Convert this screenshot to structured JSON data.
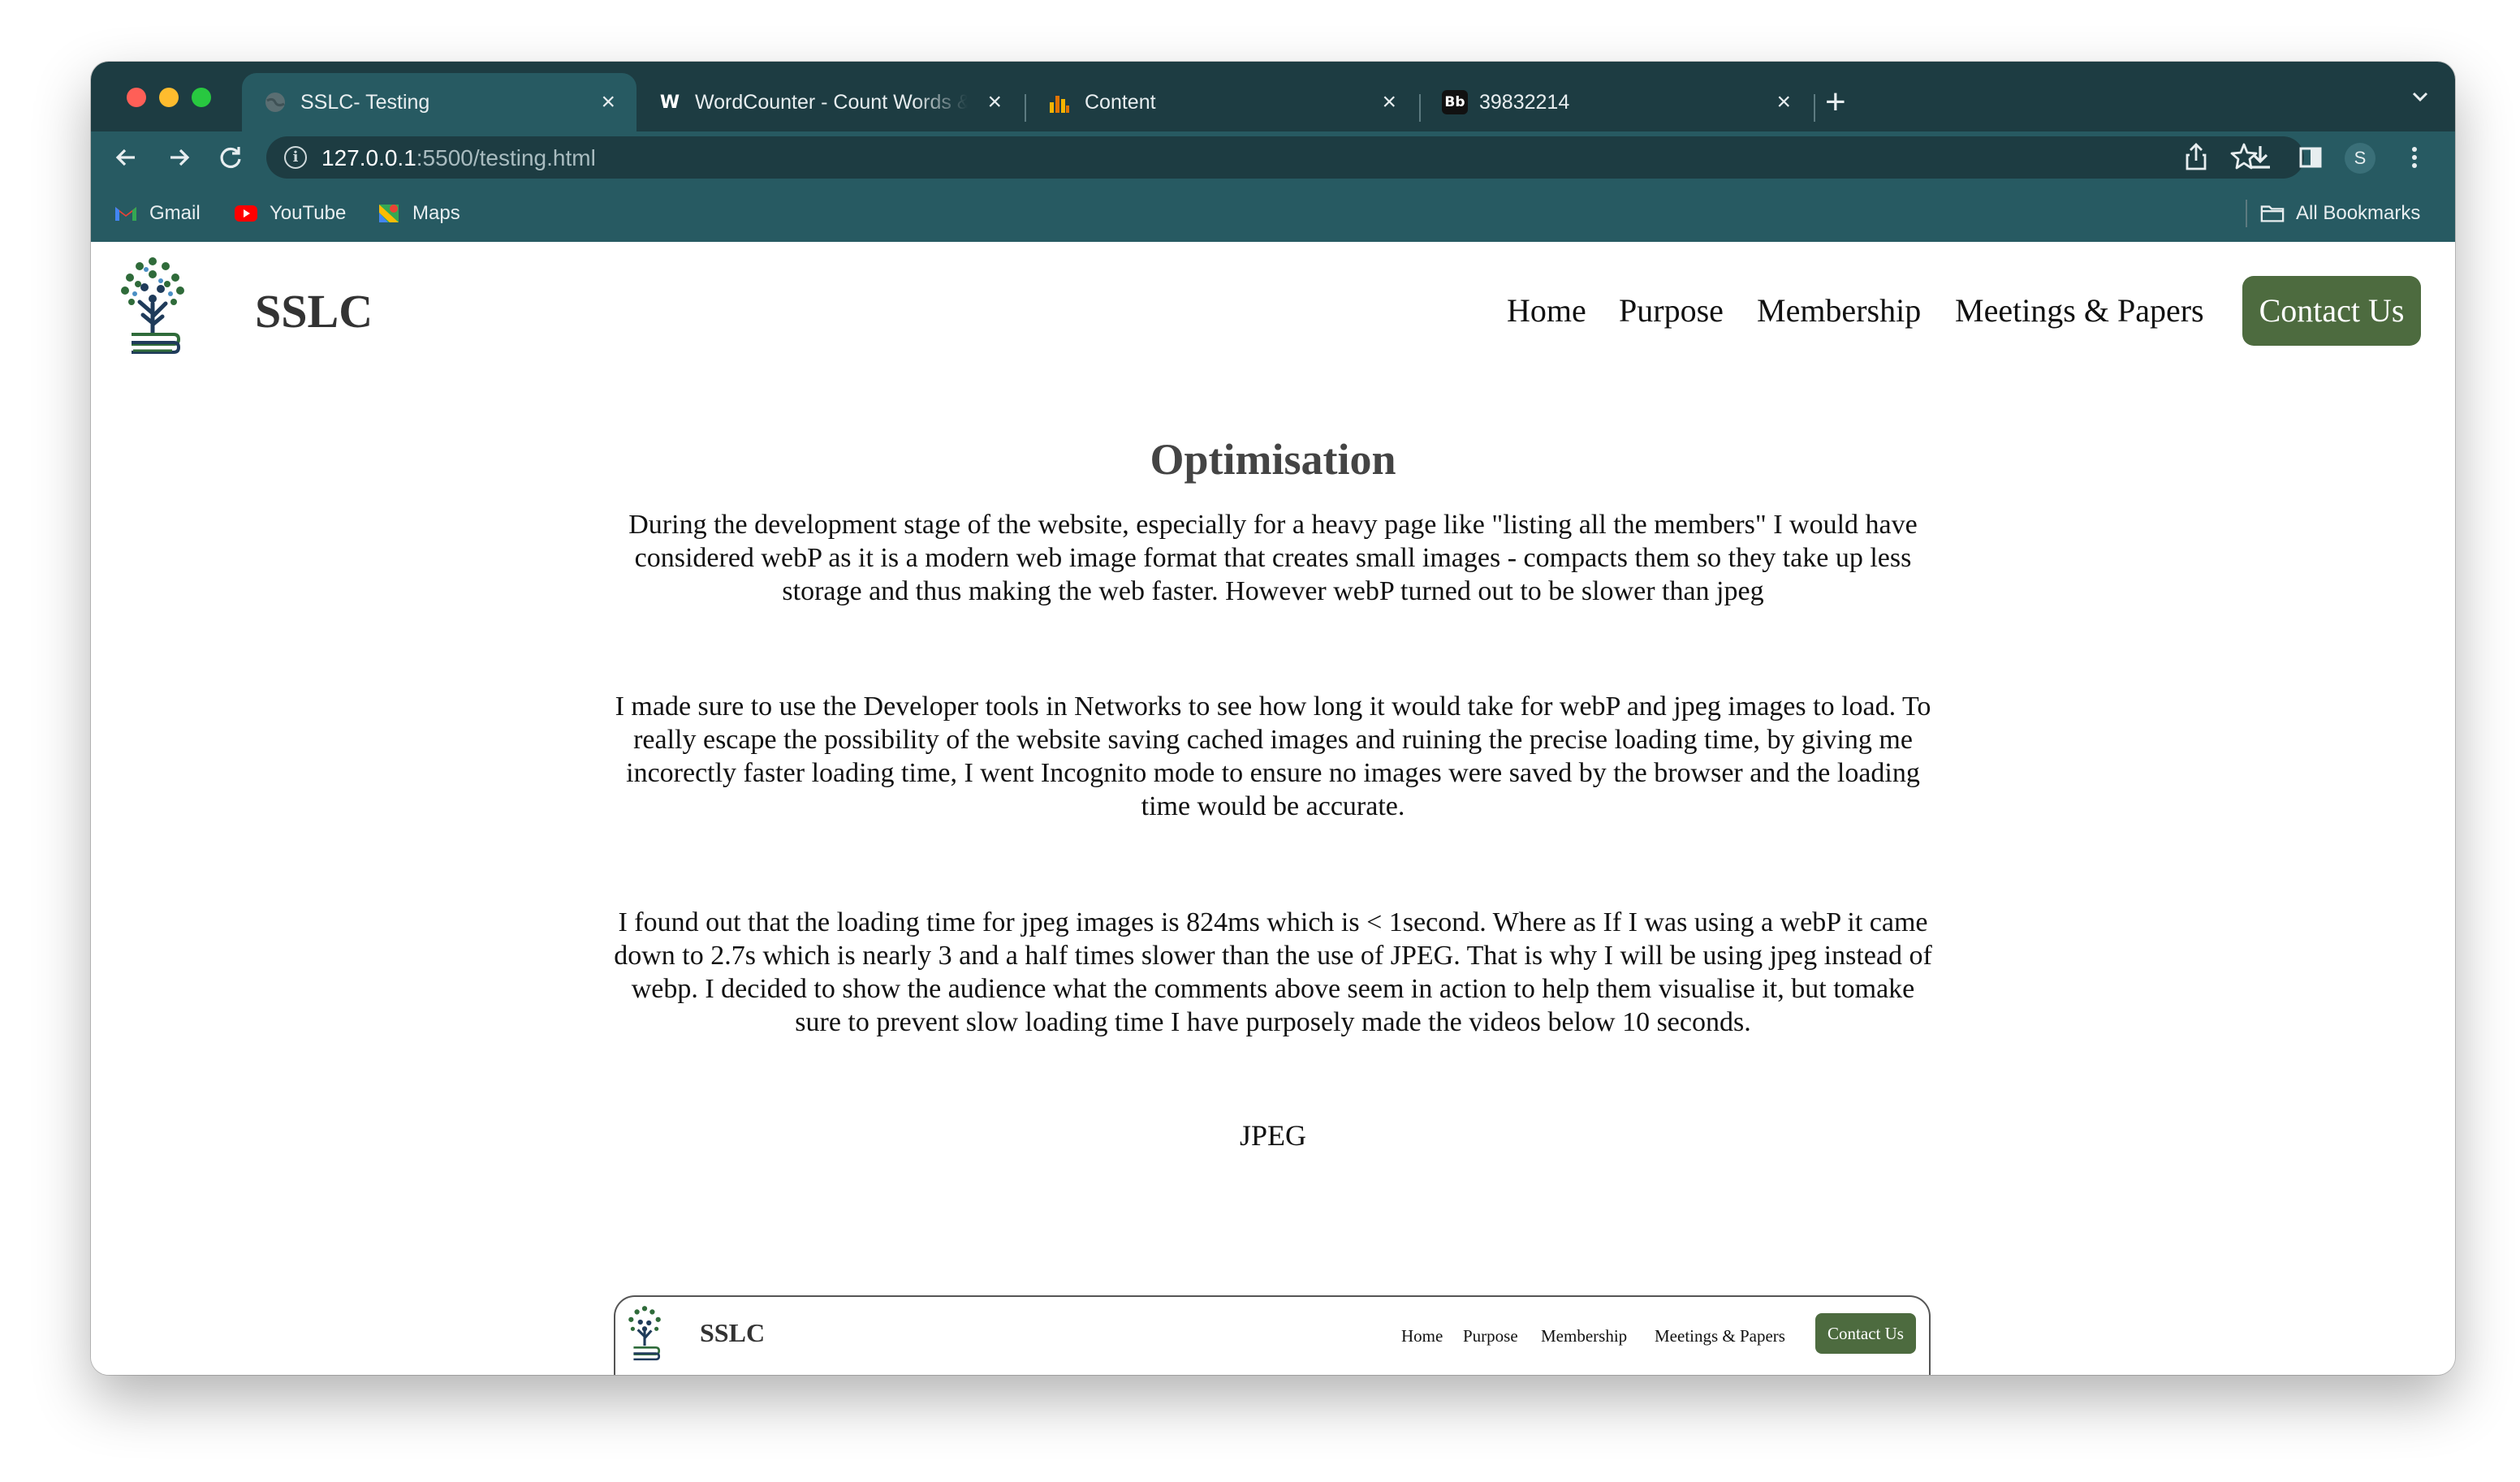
{
  "browser": {
    "tabs": [
      {
        "title": "SSLC- Testing",
        "favicon": "globe-icon"
      },
      {
        "title": "WordCounter - Count Words & Correct Writing",
        "favicon": "wordcounter-w-icon"
      },
      {
        "title": "Content",
        "favicon": "bar-chart-icon"
      },
      {
        "title": "39832214",
        "favicon": "blackboard-bb-icon"
      }
    ],
    "url_host": "127.0.0.1",
    "url_rest": ":5500/testing.html",
    "profile_initial": "S",
    "bookmarks": [
      "Gmail",
      "YouTube",
      "Maps"
    ],
    "all_bookmarks_label": "All Bookmarks",
    "wordcounter_favicon_letter": "W",
    "bb_favicon_letters": "Bb"
  },
  "site": {
    "brand": "SSLC",
    "nav": {
      "home": "Home",
      "purpose": "Purpose",
      "membership": "Membership",
      "meetings": "Meetings & Papers",
      "contact": "Contact Us"
    },
    "accent_color": "#4d6b3f",
    "heading": "Optimisation",
    "paragraphs": [
      "During the development stage of the website, especially for a heavy page like \"listing all the members\" I would have considered webP as it is a modern web image format that creates small images - compacts them so they take up less storage and thus making the web faster. However webP turned out to be slower than jpeg",
      "I made sure to use the Developer tools in Networks to see how long it would take for webP and jpeg images to load. To really escape the possibility of the website saving cached images and ruining the precise loading time, by giving me incorectly faster loading time, I went Incognito mode to ensure no images were saved by the browser and the loading time would be accurate.",
      "I found out that the loading time for jpeg images is 824ms which is < 1second. Where as If I was using a webP it came down to 2.7s which is nearly 3 and a half times slower than the use of JPEG. That is why I will be using jpeg instead of webp. I decided to show the audience what the comments above seem in action to help them visualise it, but tomake sure to prevent slow loading time I have purposely made the videos below 10 seconds."
    ],
    "video_label": "JPEG"
  },
  "preview": {
    "brand": "SSLC",
    "nav": {
      "home": "Home",
      "purpose": "Purpose",
      "membership": "Membership",
      "meetings": "Meetings & Papers",
      "contact": "Contact Us"
    }
  }
}
